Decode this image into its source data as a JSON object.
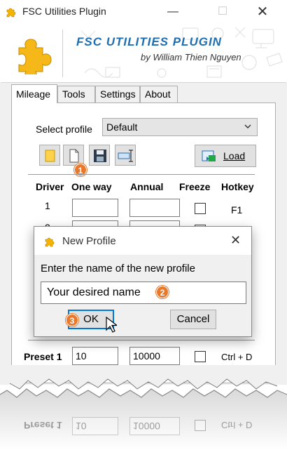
{
  "window": {
    "title": "FSC Utilities Plugin",
    "minimize_glyph": "—",
    "maximize_glyph": "☐",
    "close_glyph": "✕"
  },
  "banner": {
    "plugin_name": "FSC UTILITIES PLUGIN",
    "author": "by William Thien Nguyen",
    "logo_icon": "puzzle-piece-icon"
  },
  "tabs": [
    {
      "label": "Mileage",
      "active": true
    },
    {
      "label": "Tools",
      "active": false
    },
    {
      "label": "Settings",
      "active": false
    },
    {
      "label": "About",
      "active": false
    }
  ],
  "profile": {
    "label": "Select profile",
    "selected": "Default"
  },
  "toolbar": {
    "buttons": [
      "open-folder-icon",
      "new-file-icon",
      "save-icon",
      "rename-icon"
    ],
    "load_label": "Load"
  },
  "table": {
    "headers": [
      "Driver",
      "One way",
      "Annual",
      "Freeze",
      "Hotkey"
    ],
    "rows": [
      {
        "driver": "1",
        "one_way": "",
        "annual": "",
        "freeze": false,
        "hotkey": "F1"
      },
      {
        "driver": "2",
        "one_way": "",
        "annual": "",
        "freeze": false,
        "hotkey": ""
      }
    ]
  },
  "preset": {
    "label": "Preset 1",
    "one_way": "10",
    "annual": "10000",
    "freeze": false,
    "hotkey": "Ctrl + D"
  },
  "reflection": {
    "label": "Preset 1",
    "one_way": "10",
    "annual": "10000",
    "hotkey": "Ctrl + D"
  },
  "dialog": {
    "title": "New Profile",
    "prompt": "Enter the name of the new profile",
    "input_value": "Your desired name",
    "ok_label": "OK",
    "cancel_label": "Cancel",
    "close_glyph": "✕"
  },
  "badges": [
    "1",
    "2",
    "3"
  ],
  "colors": {
    "accent": "#1d6fb1",
    "badge": "#e8782c",
    "focus": "#0078d7"
  }
}
